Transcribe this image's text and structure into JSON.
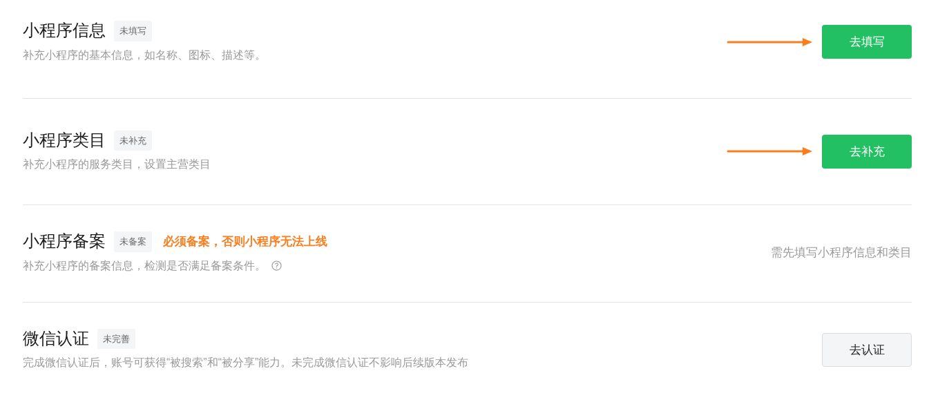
{
  "sections": [
    {
      "title": "小程序信息",
      "status": "未填写",
      "description": "补充小程序的基本信息，如名称、图标、描述等。",
      "arrow": true,
      "action": {
        "kind": "primary",
        "label": "去填写"
      }
    },
    {
      "title": "小程序类目",
      "status": "未补充",
      "description": "补充小程序的服务类目，设置主营类目",
      "arrow": true,
      "action": {
        "kind": "primary",
        "label": "去补充"
      }
    },
    {
      "title": "小程序备案",
      "status": "未备案",
      "warning": "必须备案，否则小程序无法上线",
      "description": "补充小程序的备案信息，检测是否满足备案条件。",
      "help": true,
      "action": {
        "kind": "note",
        "label": "需先填写小程序信息和类目"
      }
    },
    {
      "title": "微信认证",
      "status": "未完善",
      "description": "完成微信认证后，账号可获得“被搜索”和“被分享”能力。未完成微信认证不影响后续版本发布",
      "action": {
        "kind": "default",
        "label": "去认证"
      }
    }
  ]
}
